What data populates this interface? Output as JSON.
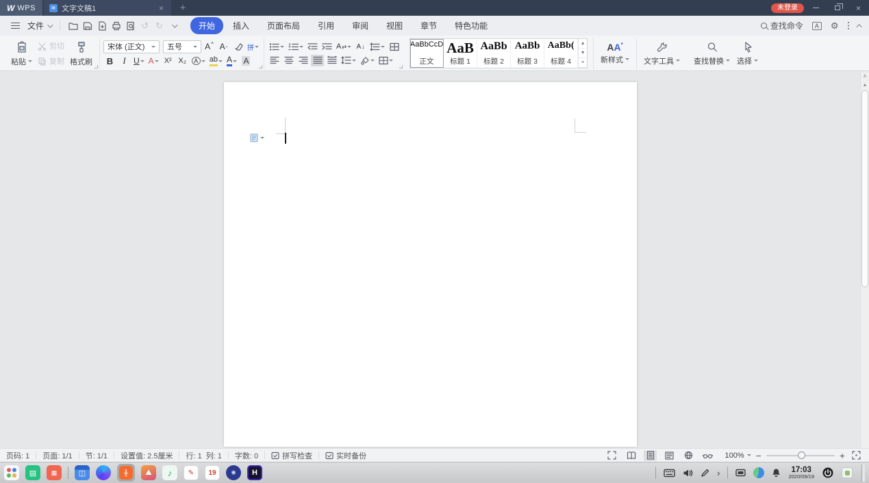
{
  "titlebar": {
    "app_name": "WPS",
    "logo_letter": "W",
    "tab_title": "文字文稿1",
    "login_badge": "未登录"
  },
  "menubar": {
    "file_label": "文件",
    "tabs": [
      "开始",
      "插入",
      "页面布局",
      "引用",
      "审阅",
      "视图",
      "章节",
      "特色功能"
    ],
    "find_command": "查找命令"
  },
  "ribbon": {
    "paste": "粘贴",
    "cut": "剪切",
    "copy": "复制",
    "format_painter": "格式刷",
    "font_name": "宋体 (正文)",
    "font_size": "五号",
    "bold": "B",
    "italic": "I",
    "underline": "U",
    "strike": "A",
    "superscript": "X²",
    "subscript": "X₂",
    "circle_char": "A",
    "highlight": "ab",
    "font_color": "A",
    "char_shading": "A",
    "char_scale": "A",
    "sort": "A",
    "pinyin": "拼",
    "styles": [
      {
        "preview": "AaBbCcD",
        "label": "正文"
      },
      {
        "preview": "AaB",
        "label": "标题 1"
      },
      {
        "preview": "AaBb",
        "label": "标题 2"
      },
      {
        "preview": "AaBb",
        "label": "标题 3"
      },
      {
        "preview": "AaBb(",
        "label": "标题 4"
      }
    ],
    "new_style": "新样式",
    "text_tool": "文字工具",
    "find_replace": "查找替换",
    "select": "选择"
  },
  "statusbar": {
    "page_number": "页码: 1",
    "page": "页面: 1/1",
    "section": "节: 1/1",
    "setting": "设置值: 2.5厘米",
    "line": "行: 1",
    "column": "列: 1",
    "word_count": "字数: 0",
    "spellcheck": "拼写检查",
    "backup": "实时备份",
    "zoom": "100%"
  },
  "taskbar": {
    "time": "17:03",
    "date": "2020/09/19",
    "calendar_day": "19",
    "app_h_letter": "H"
  },
  "colors": {
    "accent_blue": "#3f66e0",
    "titlebar": "#333e50",
    "badge_red": "#e0564a"
  }
}
